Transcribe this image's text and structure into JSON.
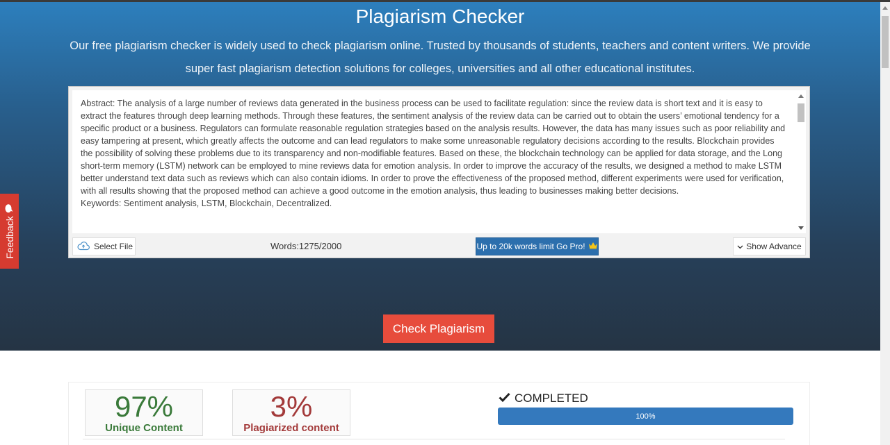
{
  "hero": {
    "title": "Plagiarism Checker",
    "subtitle": "Our free plagiarism checker is widely used to check plagiarism online. Trusted by thousands of students, teachers and content writers. We provide super fast plagiarism detection solutions for colleges, universities and all other educational institutes."
  },
  "editor": {
    "paragraphs": [
      "Abstract: The analysis of a large number of reviews data generated in the business process can be used to facilitate regulation: since the review data is short text and it is easy to extract the features through deep learning methods. Through these features, the sentiment analysis of the review data can be carried out to obtain the users’ emotional tendency for a specific product or a business. Regulators can formulate reasonable regulation strategies based on the analysis results. However, the data has many issues such as poor reliability and easy tampering at present, which greatly affects the outcome and can lead regulators to make some unreasonable regulatory decisions according to the results. Blockchain provides the possibility of solving these problems due to its transparency and non-modifiable features. Based on these, the blockchain technology can be applied for data storage, and the Long short-term memory (LSTM) network can be employed to mine reviews data for emotion analysis. In order to improve the accuracy of the results, we designed a method to make LSTM better understand text data such as reviews which can also contain idioms. In order to prove the effectiveness of the proposed method, different experiments were used for verification, with all results showing that the proposed method can achieve a good outcome in the emotion analysis, thus leading to businesses making better decisions.",
      "Keywords: Sentiment analysis, LSTM, Blockchain, Decentralized."
    ],
    "select_file": "Select File",
    "words": "Words:1275/2000",
    "gopro": "Up to 20k words limit Go Pro!",
    "show_advance": "Show Advance"
  },
  "check_button": "Check Plagiarism",
  "feedback": "Feedback",
  "results": {
    "unique_value": "97%",
    "unique_label": "Unique Content",
    "plag_value": "3%",
    "plag_label": "Plagiarized content",
    "status": "COMPLETED",
    "progress_label": "100%",
    "progress": 1.0
  },
  "colors": {
    "accent_blue": "#2c6fad",
    "check_red": "#e74c3c",
    "unique_green": "#3a7a3a",
    "plag_red": "#a33a3a"
  },
  "icons": [
    "cloud-upload-icon",
    "crown-icon",
    "chevron-down-icon",
    "check-icon",
    "comment-icon"
  ]
}
